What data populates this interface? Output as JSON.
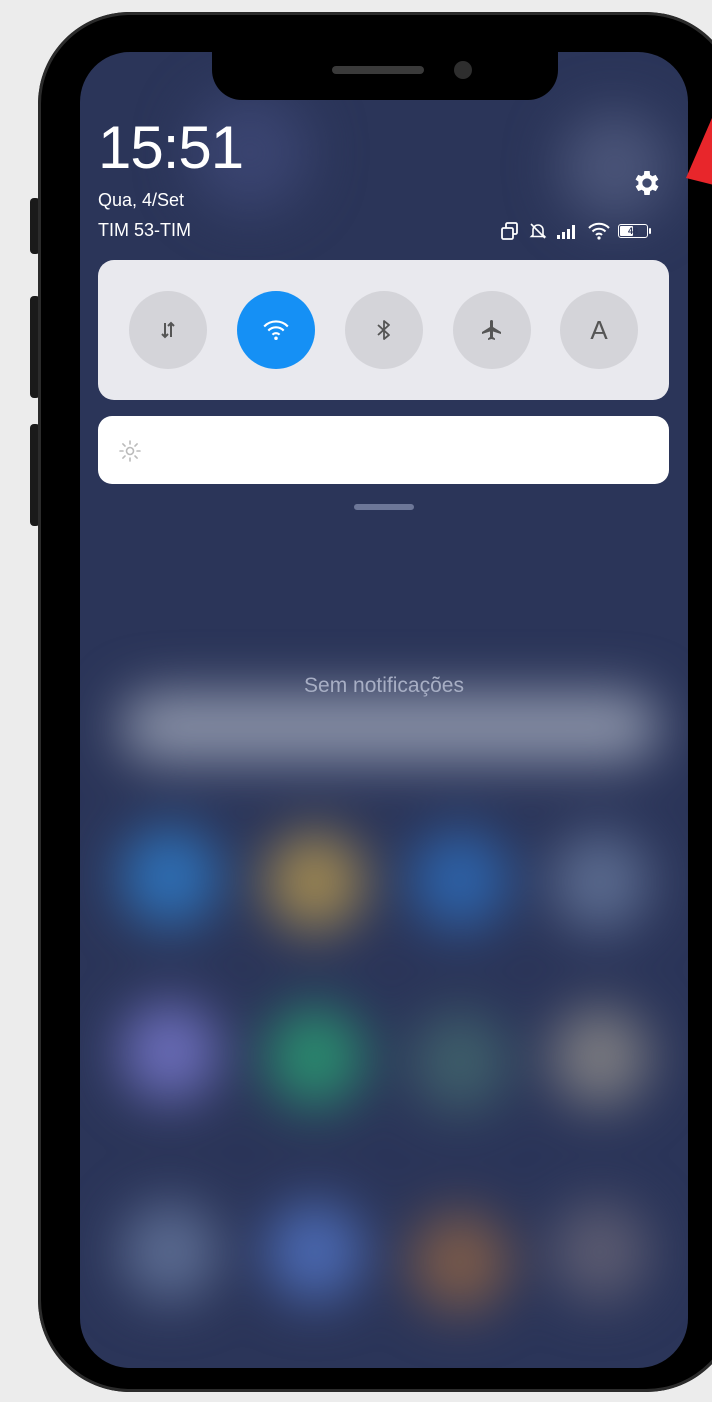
{
  "status": {
    "time": "15:51",
    "date": "Qua, 4/Set",
    "carrier": "TIM 53-TIM",
    "battery_level": "48"
  },
  "quick_settings": {
    "toggles": [
      {
        "id": "mobile-data",
        "icon": "data-transfer-icon",
        "active": false
      },
      {
        "id": "wifi",
        "icon": "wifi-icon",
        "active": true
      },
      {
        "id": "bluetooth",
        "icon": "bluetooth-icon",
        "active": false
      },
      {
        "id": "airplane",
        "icon": "airplane-icon",
        "active": false
      },
      {
        "id": "auto-brightness",
        "icon": "auto-brightness-icon",
        "label": "A",
        "active": false
      }
    ]
  },
  "notifications": {
    "empty_text": "Sem notificações"
  },
  "colors": {
    "accent": "#1590f5",
    "panel_bg": "#2b3559",
    "annotation": "#e8262b"
  }
}
